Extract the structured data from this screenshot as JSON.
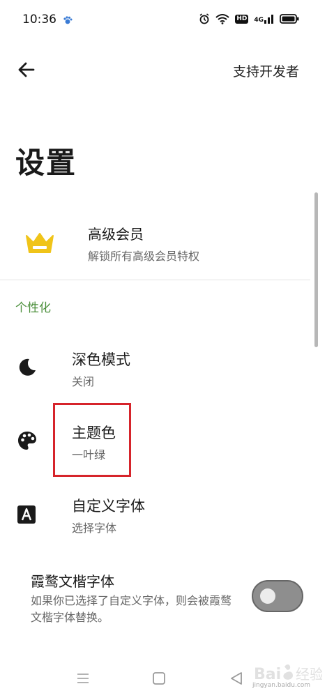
{
  "status_bar": {
    "time": "10:36",
    "hd_label": "HD",
    "network_label": "4G"
  },
  "header": {
    "back_icon": "arrow-left-icon",
    "support_label": "支持开发者"
  },
  "page": {
    "title": "设置"
  },
  "premium": {
    "icon": "crown-icon",
    "title": "高级会员",
    "subtitle": "解锁所有高级会员特权",
    "accent_color": "#f0c419"
  },
  "section": {
    "label": "个性化",
    "color": "#4b8f3b"
  },
  "settings": [
    {
      "icon": "moon-icon",
      "title": "深色模式",
      "subtitle": "关闭"
    },
    {
      "icon": "palette-icon",
      "title": "主题色",
      "subtitle": "一叶绿"
    },
    {
      "icon": "font-a-icon",
      "title": "自定义字体",
      "subtitle": "选择字体"
    }
  ],
  "font_toggle": {
    "title": "霞鹜文楷字体",
    "description": "如果你已选择了自定义字体，则会被霞鹜文楷字体替换。",
    "enabled": false
  },
  "highlight_color": "#d6242b",
  "nav_bar": {
    "menu_icon": "menu-icon",
    "home_icon": "home-square-icon",
    "back_icon": "back-triangle-icon"
  },
  "watermark": {
    "text": "jingyan.baidu.com"
  }
}
